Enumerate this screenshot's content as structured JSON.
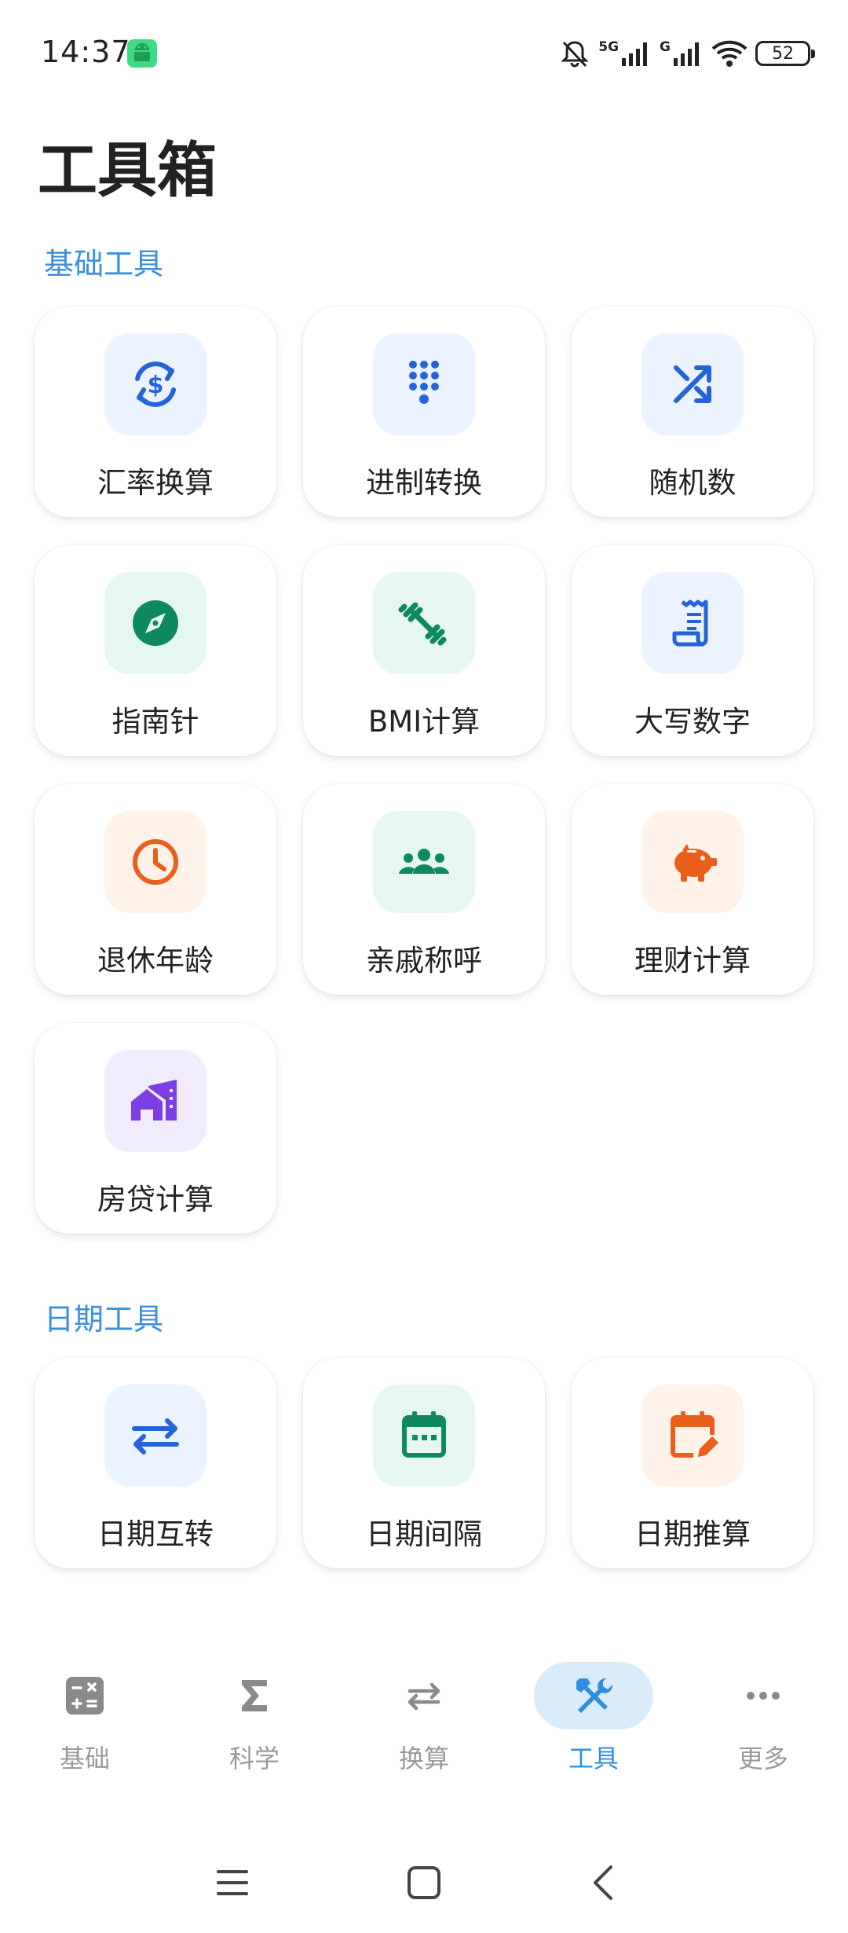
{
  "status_bar": {
    "time": "14:37",
    "network_1": "5G",
    "network_2": "G",
    "battery": "52"
  },
  "page_title": "工具箱",
  "sections": [
    {
      "title": "基础工具",
      "items": [
        {
          "label": "汇率换算",
          "icon": "currency-exchange-icon",
          "color": "#2563d8"
        },
        {
          "label": "进制转换",
          "icon": "dialpad-icon",
          "color": "#2563d8"
        },
        {
          "label": "随机数",
          "icon": "shuffle-icon",
          "color": "#2563d8"
        },
        {
          "label": "指南针",
          "icon": "compass-icon",
          "color": "#0f8a5f"
        },
        {
          "label": "BMI计算",
          "icon": "fitness-icon",
          "color": "#0f8a5f"
        },
        {
          "label": "大写数字",
          "icon": "receipt-icon",
          "color": "#2563d8"
        },
        {
          "label": "退休年龄",
          "icon": "clock-icon",
          "color": "#e8601c"
        },
        {
          "label": "亲戚称呼",
          "icon": "groups-icon",
          "color": "#0f8a5f"
        },
        {
          "label": "理财计算",
          "icon": "piggy-bank-icon",
          "color": "#e8601c"
        },
        {
          "label": "房贷计算",
          "icon": "house-icon",
          "color": "#7b3fe4"
        }
      ]
    },
    {
      "title": "日期工具",
      "items": [
        {
          "label": "日期互转",
          "icon": "swap-arrows-icon",
          "color": "#2563d8"
        },
        {
          "label": "日期间隔",
          "icon": "calendar-icon",
          "color": "#0f8a5f"
        },
        {
          "label": "日期推算",
          "icon": "calendar-edit-icon",
          "color": "#e8601c"
        }
      ]
    }
  ],
  "bottom_nav": [
    {
      "label": "基础",
      "icon": "calculator-icon",
      "active": false
    },
    {
      "label": "科学",
      "icon": "sigma-icon",
      "active": false
    },
    {
      "label": "换算",
      "icon": "swap-icon",
      "active": false
    },
    {
      "label": "工具",
      "icon": "tools-icon",
      "active": true
    },
    {
      "label": "更多",
      "icon": "more-icon",
      "active": false
    }
  ],
  "colors": {
    "accent": "#3b8ee0",
    "nav_active_bg": "#d9ecfb"
  }
}
